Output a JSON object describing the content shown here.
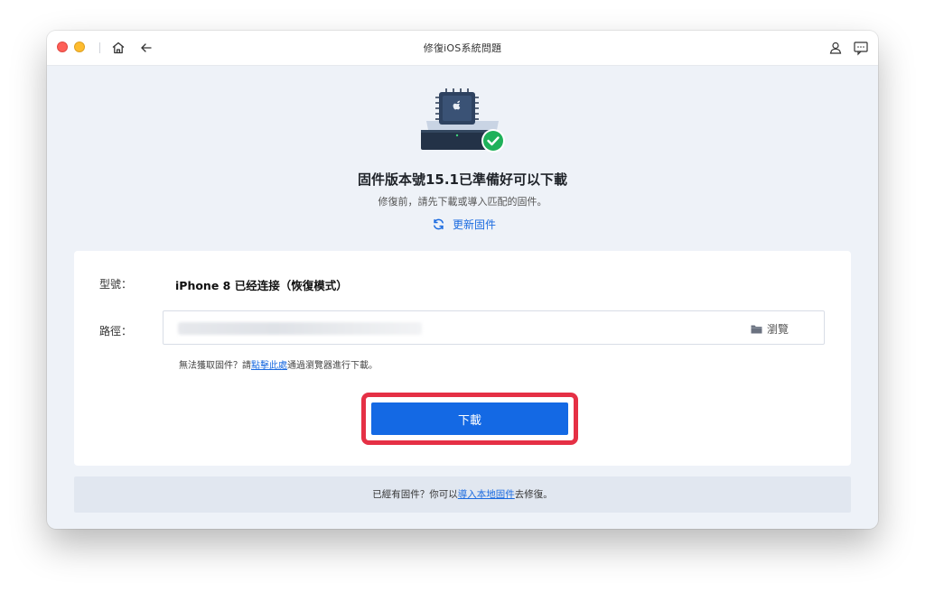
{
  "window": {
    "title": "修復iOS系統問題"
  },
  "icons": {
    "close": "close-dot",
    "minimize": "minimize-dot",
    "home": "home-icon",
    "back": "arrow-left-icon",
    "account": "user-icon",
    "feedback": "message-icon",
    "firmware": "chip-check-icon",
    "refresh": "refresh-icon",
    "folder": "folder-icon"
  },
  "hero": {
    "title": "固件版本號15.1已準備好可以下載",
    "subtitle": "修復前，請先下載或導入匹配的固件。",
    "refresh_label": "更新固件"
  },
  "form": {
    "model_label": "型號：",
    "model_value": "iPhone 8 已经连接（恢復模式）",
    "path_label": "路徑：",
    "path_value": "",
    "browse_label": "瀏覽",
    "hint_prefix": "無法獲取固件？請",
    "hint_link": "點擊此處",
    "hint_suffix": "通過瀏覽器進行下載。"
  },
  "download_button": "下載",
  "footer": {
    "prefix": "已經有固件？你可以",
    "link": "導入本地固件",
    "suffix": "去修復。"
  },
  "colors": {
    "accent": "#1469e4",
    "highlight": "#e53045",
    "success": "#1fb15a"
  }
}
